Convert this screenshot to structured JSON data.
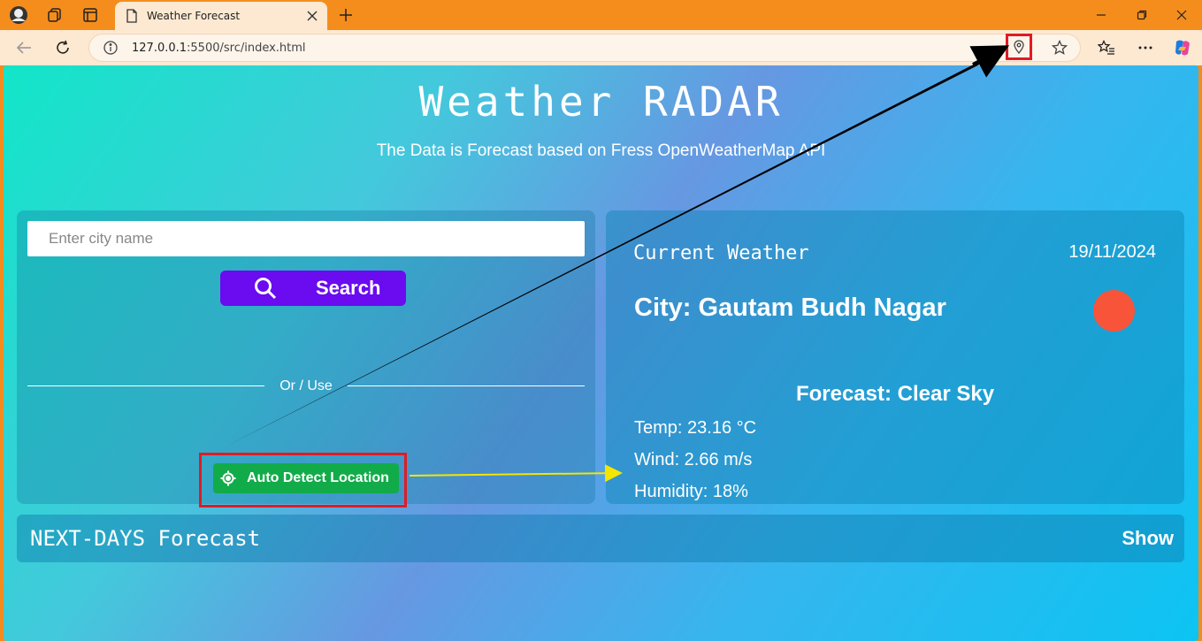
{
  "browser": {
    "tab_title": "Weather Forecast",
    "url_host": "127.0.0.1",
    "url_path": ":5500/src/index.html"
  },
  "header": {
    "title": "Weather RADAR",
    "subtitle": "The Data is Forecast based on Fress OpenWeatherMap API"
  },
  "search": {
    "placeholder": "Enter city name",
    "button_label": "Search",
    "or_use": "Or / Use",
    "auto_detect_label": "Auto Detect Location"
  },
  "current": {
    "title": "Current Weather",
    "date": "19/11/2024",
    "city": "City: Gautam Budh Nagar",
    "forecast": "Forecast: Clear Sky",
    "temp": "Temp: 23.16 °C",
    "wind": "Wind: 2.66 m/s",
    "humidity": "Humidity: 18%"
  },
  "next_days": {
    "title": "NEXT-DAYS Forecast",
    "show_label": "Show"
  },
  "colors": {
    "accent_search": "#6a0bf0",
    "accent_auto": "#12ab49",
    "highlight_box": "#e01b24",
    "sun": "#f7543a"
  },
  "icons": [
    "avatar-icon",
    "collections-icon",
    "tab-actions-icon",
    "page-icon",
    "close-icon",
    "plus-icon",
    "back-icon",
    "reload-icon",
    "info-icon",
    "location-pin-icon",
    "star-icon",
    "favorites-icon",
    "more-icon",
    "copilot-icon",
    "search-icon",
    "crosshair-icon"
  ]
}
